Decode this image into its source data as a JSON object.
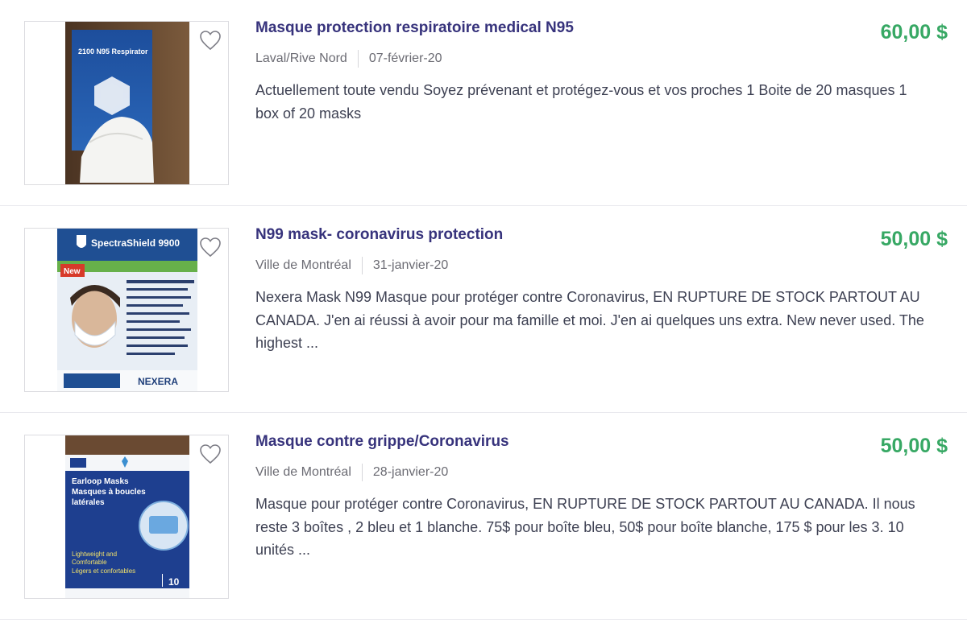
{
  "colors": {
    "title": "#37337c",
    "price": "#37a864",
    "meta": "#6b6b73",
    "description": "#3e4153"
  },
  "listings": [
    {
      "title": "Masque protection respiratoire medical N95",
      "location": "Laval/Rive Nord",
      "date": "07-février-20",
      "price": "60,00 $",
      "description": "Actuellement toute vendu Soyez prévenant et protégez-vous et vos proches 1 Boite de 20 masques 1 box of 20 masks",
      "favorite_icon": "heart-outline-icon",
      "image": {
        "alt": "N95 respirator box",
        "box_text": "2100 N95 Respirator"
      }
    },
    {
      "title": "N99 mask- coronavirus protection",
      "location": "Ville de Montréal",
      "date": "31-janvier-20",
      "price": "50,00 $",
      "description": "Nexera Mask N99 Masque pour protéger contre Coronavirus, EN RUPTURE DE STOCK PARTOUT AU CANADA. J'en ai réussi à avoir pour ma famille et moi. J'en ai quelques uns extra. New never used. The highest ...",
      "favorite_icon": "heart-outline-icon",
      "image": {
        "alt": "SpectraShield 9900 N99 mask package",
        "brand_text": "SpectraShield 9900",
        "badge_text": "New",
        "logo_text": "NEXERA"
      }
    },
    {
      "title": "Masque contre grippe/Coronavirus",
      "location": "Ville de Montréal",
      "date": "28-janvier-20",
      "price": "50,00 $",
      "description": "Masque pour protéger contre Coronavirus, EN RUPTURE DE STOCK PARTOUT AU CANADA. Il nous reste 3 boîtes , 2 bleu et 1 blanche. 75$ pour boîte bleu, 50$ pour boîte blanche, 175 $ pour les 3. 10 unités ...",
      "favorite_icon": "heart-outline-icon",
      "image": {
        "alt": "Earloop masks box",
        "line1": "Earloop Masks",
        "line2": "Masques à boucles",
        "line3": "latérales",
        "line4": "Lightweight and",
        "line5": "Comfortable",
        "line6": "Légers et confortables",
        "count": "10"
      }
    }
  ]
}
